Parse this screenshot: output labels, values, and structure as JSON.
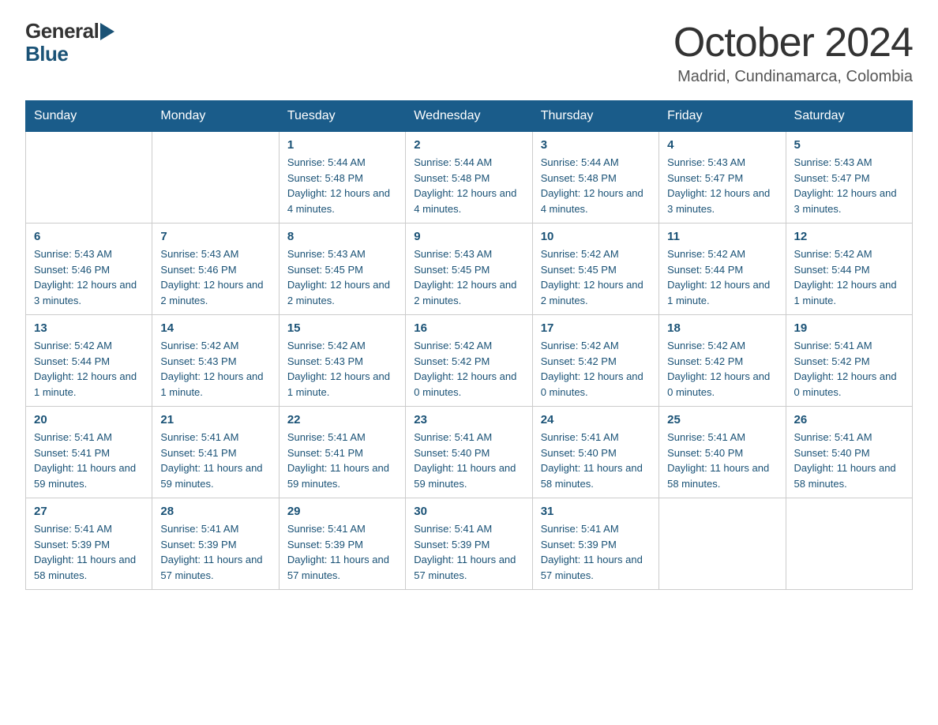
{
  "header": {
    "logo": {
      "general": "General",
      "blue": "Blue",
      "triangle_color": "#1a5276"
    },
    "title": "October 2024",
    "location": "Madrid, Cundinamarca, Colombia"
  },
  "calendar": {
    "days_of_week": [
      "Sunday",
      "Monday",
      "Tuesday",
      "Wednesday",
      "Thursday",
      "Friday",
      "Saturday"
    ],
    "weeks": [
      {
        "cells": [
          {
            "day": "",
            "sunrise": "",
            "sunset": "",
            "daylight": ""
          },
          {
            "day": "",
            "sunrise": "",
            "sunset": "",
            "daylight": ""
          },
          {
            "day": "1",
            "sunrise": "Sunrise: 5:44 AM",
            "sunset": "Sunset: 5:48 PM",
            "daylight": "Daylight: 12 hours and 4 minutes."
          },
          {
            "day": "2",
            "sunrise": "Sunrise: 5:44 AM",
            "sunset": "Sunset: 5:48 PM",
            "daylight": "Daylight: 12 hours and 4 minutes."
          },
          {
            "day": "3",
            "sunrise": "Sunrise: 5:44 AM",
            "sunset": "Sunset: 5:48 PM",
            "daylight": "Daylight: 12 hours and 4 minutes."
          },
          {
            "day": "4",
            "sunrise": "Sunrise: 5:43 AM",
            "sunset": "Sunset: 5:47 PM",
            "daylight": "Daylight: 12 hours and 3 minutes."
          },
          {
            "day": "5",
            "sunrise": "Sunrise: 5:43 AM",
            "sunset": "Sunset: 5:47 PM",
            "daylight": "Daylight: 12 hours and 3 minutes."
          }
        ]
      },
      {
        "cells": [
          {
            "day": "6",
            "sunrise": "Sunrise: 5:43 AM",
            "sunset": "Sunset: 5:46 PM",
            "daylight": "Daylight: 12 hours and 3 minutes."
          },
          {
            "day": "7",
            "sunrise": "Sunrise: 5:43 AM",
            "sunset": "Sunset: 5:46 PM",
            "daylight": "Daylight: 12 hours and 2 minutes."
          },
          {
            "day": "8",
            "sunrise": "Sunrise: 5:43 AM",
            "sunset": "Sunset: 5:45 PM",
            "daylight": "Daylight: 12 hours and 2 minutes."
          },
          {
            "day": "9",
            "sunrise": "Sunrise: 5:43 AM",
            "sunset": "Sunset: 5:45 PM",
            "daylight": "Daylight: 12 hours and 2 minutes."
          },
          {
            "day": "10",
            "sunrise": "Sunrise: 5:42 AM",
            "sunset": "Sunset: 5:45 PM",
            "daylight": "Daylight: 12 hours and 2 minutes."
          },
          {
            "day": "11",
            "sunrise": "Sunrise: 5:42 AM",
            "sunset": "Sunset: 5:44 PM",
            "daylight": "Daylight: 12 hours and 1 minute."
          },
          {
            "day": "12",
            "sunrise": "Sunrise: 5:42 AM",
            "sunset": "Sunset: 5:44 PM",
            "daylight": "Daylight: 12 hours and 1 minute."
          }
        ]
      },
      {
        "cells": [
          {
            "day": "13",
            "sunrise": "Sunrise: 5:42 AM",
            "sunset": "Sunset: 5:44 PM",
            "daylight": "Daylight: 12 hours and 1 minute."
          },
          {
            "day": "14",
            "sunrise": "Sunrise: 5:42 AM",
            "sunset": "Sunset: 5:43 PM",
            "daylight": "Daylight: 12 hours and 1 minute."
          },
          {
            "day": "15",
            "sunrise": "Sunrise: 5:42 AM",
            "sunset": "Sunset: 5:43 PM",
            "daylight": "Daylight: 12 hours and 1 minute."
          },
          {
            "day": "16",
            "sunrise": "Sunrise: 5:42 AM",
            "sunset": "Sunset: 5:42 PM",
            "daylight": "Daylight: 12 hours and 0 minutes."
          },
          {
            "day": "17",
            "sunrise": "Sunrise: 5:42 AM",
            "sunset": "Sunset: 5:42 PM",
            "daylight": "Daylight: 12 hours and 0 minutes."
          },
          {
            "day": "18",
            "sunrise": "Sunrise: 5:42 AM",
            "sunset": "Sunset: 5:42 PM",
            "daylight": "Daylight: 12 hours and 0 minutes."
          },
          {
            "day": "19",
            "sunrise": "Sunrise: 5:41 AM",
            "sunset": "Sunset: 5:42 PM",
            "daylight": "Daylight: 12 hours and 0 minutes."
          }
        ]
      },
      {
        "cells": [
          {
            "day": "20",
            "sunrise": "Sunrise: 5:41 AM",
            "sunset": "Sunset: 5:41 PM",
            "daylight": "Daylight: 11 hours and 59 minutes."
          },
          {
            "day": "21",
            "sunrise": "Sunrise: 5:41 AM",
            "sunset": "Sunset: 5:41 PM",
            "daylight": "Daylight: 11 hours and 59 minutes."
          },
          {
            "day": "22",
            "sunrise": "Sunrise: 5:41 AM",
            "sunset": "Sunset: 5:41 PM",
            "daylight": "Daylight: 11 hours and 59 minutes."
          },
          {
            "day": "23",
            "sunrise": "Sunrise: 5:41 AM",
            "sunset": "Sunset: 5:40 PM",
            "daylight": "Daylight: 11 hours and 59 minutes."
          },
          {
            "day": "24",
            "sunrise": "Sunrise: 5:41 AM",
            "sunset": "Sunset: 5:40 PM",
            "daylight": "Daylight: 11 hours and 58 minutes."
          },
          {
            "day": "25",
            "sunrise": "Sunrise: 5:41 AM",
            "sunset": "Sunset: 5:40 PM",
            "daylight": "Daylight: 11 hours and 58 minutes."
          },
          {
            "day": "26",
            "sunrise": "Sunrise: 5:41 AM",
            "sunset": "Sunset: 5:40 PM",
            "daylight": "Daylight: 11 hours and 58 minutes."
          }
        ]
      },
      {
        "cells": [
          {
            "day": "27",
            "sunrise": "Sunrise: 5:41 AM",
            "sunset": "Sunset: 5:39 PM",
            "daylight": "Daylight: 11 hours and 58 minutes."
          },
          {
            "day": "28",
            "sunrise": "Sunrise: 5:41 AM",
            "sunset": "Sunset: 5:39 PM",
            "daylight": "Daylight: 11 hours and 57 minutes."
          },
          {
            "day": "29",
            "sunrise": "Sunrise: 5:41 AM",
            "sunset": "Sunset: 5:39 PM",
            "daylight": "Daylight: 11 hours and 57 minutes."
          },
          {
            "day": "30",
            "sunrise": "Sunrise: 5:41 AM",
            "sunset": "Sunset: 5:39 PM",
            "daylight": "Daylight: 11 hours and 57 minutes."
          },
          {
            "day": "31",
            "sunrise": "Sunrise: 5:41 AM",
            "sunset": "Sunset: 5:39 PM",
            "daylight": "Daylight: 11 hours and 57 minutes."
          },
          {
            "day": "",
            "sunrise": "",
            "sunset": "",
            "daylight": ""
          },
          {
            "day": "",
            "sunrise": "",
            "sunset": "",
            "daylight": ""
          }
        ]
      }
    ]
  }
}
